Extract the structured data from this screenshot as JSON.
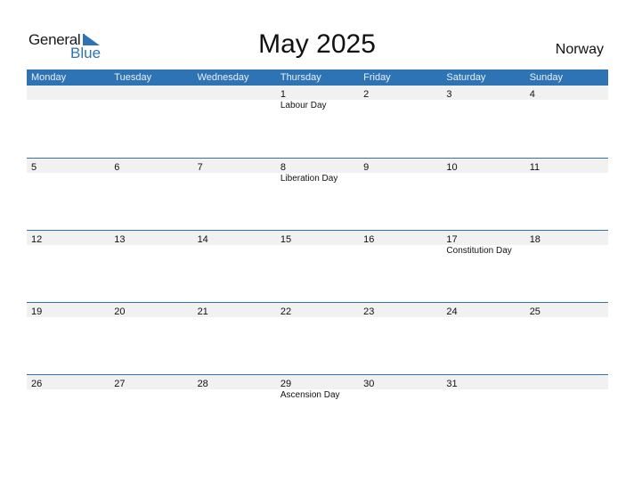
{
  "logo": {
    "line1": "General",
    "line2": "Blue",
    "accent_color": "#2e74b5"
  },
  "title": "May 2025",
  "country": "Norway",
  "header_color": "#2e74b5",
  "weekdays": [
    "Monday",
    "Tuesday",
    "Wednesday",
    "Thursday",
    "Friday",
    "Saturday",
    "Sunday"
  ],
  "weeks": [
    {
      "days": [
        {
          "num": "",
          "holiday": ""
        },
        {
          "num": "",
          "holiday": ""
        },
        {
          "num": "",
          "holiday": ""
        },
        {
          "num": "1",
          "holiday": "Labour Day"
        },
        {
          "num": "2",
          "holiday": ""
        },
        {
          "num": "3",
          "holiday": ""
        },
        {
          "num": "4",
          "holiday": ""
        }
      ]
    },
    {
      "days": [
        {
          "num": "5",
          "holiday": ""
        },
        {
          "num": "6",
          "holiday": ""
        },
        {
          "num": "7",
          "holiday": ""
        },
        {
          "num": "8",
          "holiday": "Liberation Day"
        },
        {
          "num": "9",
          "holiday": ""
        },
        {
          "num": "10",
          "holiday": ""
        },
        {
          "num": "11",
          "holiday": ""
        }
      ]
    },
    {
      "days": [
        {
          "num": "12",
          "holiday": ""
        },
        {
          "num": "13",
          "holiday": ""
        },
        {
          "num": "14",
          "holiday": ""
        },
        {
          "num": "15",
          "holiday": ""
        },
        {
          "num": "16",
          "holiday": ""
        },
        {
          "num": "17",
          "holiday": "Constitution Day"
        },
        {
          "num": "18",
          "holiday": ""
        }
      ]
    },
    {
      "days": [
        {
          "num": "19",
          "holiday": ""
        },
        {
          "num": "20",
          "holiday": ""
        },
        {
          "num": "21",
          "holiday": ""
        },
        {
          "num": "22",
          "holiday": ""
        },
        {
          "num": "23",
          "holiday": ""
        },
        {
          "num": "24",
          "holiday": ""
        },
        {
          "num": "25",
          "holiday": ""
        }
      ]
    },
    {
      "days": [
        {
          "num": "26",
          "holiday": ""
        },
        {
          "num": "27",
          "holiday": ""
        },
        {
          "num": "28",
          "holiday": ""
        },
        {
          "num": "29",
          "holiday": "Ascension Day"
        },
        {
          "num": "30",
          "holiday": ""
        },
        {
          "num": "31",
          "holiday": ""
        },
        {
          "num": "",
          "holiday": ""
        }
      ]
    }
  ]
}
